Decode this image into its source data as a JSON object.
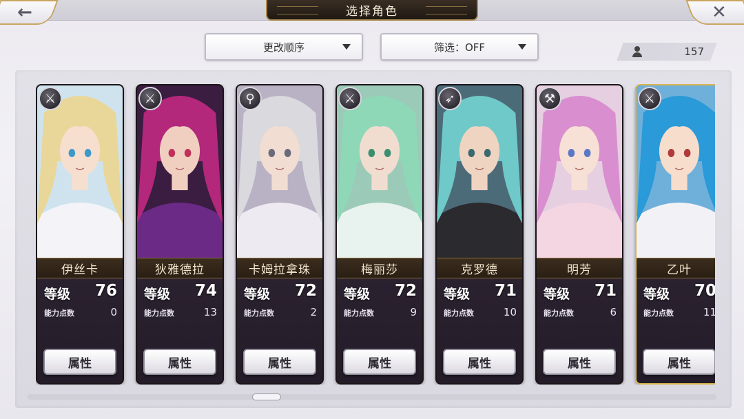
{
  "header": {
    "title": "选择角色",
    "back_icon": "←",
    "close_icon": "✕"
  },
  "toolbar": {
    "sort_label": "更改顺序",
    "filter_label": "筛选：OFF"
  },
  "roster": {
    "count": "157"
  },
  "labels": {
    "level": "等级",
    "ability_points": "能力点数",
    "attributes_button": "属性"
  },
  "characters": [
    {
      "name": "伊丝卡",
      "level": "76",
      "ability_points": "0",
      "weapon": "sword",
      "weapon_glyph": "⚔",
      "hair": "#e9d79a",
      "skin": "#f6dfcf",
      "outfit": "#f4f4f8",
      "bg": "#cfe3ef",
      "eye": "#3d9ac8"
    },
    {
      "name": "狄雅德拉",
      "level": "74",
      "ability_points": "13",
      "weapon": "sword",
      "weapon_glyph": "⚔",
      "hair": "#b3287a",
      "skin": "#f0cfc0",
      "outfit": "#6a2a86",
      "bg": "#3a1d40",
      "eye": "#c0305a"
    },
    {
      "name": "卡姆拉拿珠",
      "level": "72",
      "ability_points": "2",
      "weapon": "staff",
      "weapon_glyph": "⚲",
      "hair": "#d9d9de",
      "skin": "#f2ddd2",
      "outfit": "#eeeaf2",
      "bg": "#b9b2c4",
      "eye": "#6a6a7a"
    },
    {
      "name": "梅丽莎",
      "level": "72",
      "ability_points": "9",
      "weapon": "sword",
      "weapon_glyph": "⚔",
      "hair": "#8ed8b8",
      "skin": "#f1ddd0",
      "outfit": "#e8f2ee",
      "bg": "#9ccab8",
      "eye": "#3a8f70"
    },
    {
      "name": "克罗德",
      "level": "71",
      "ability_points": "10",
      "weapon": "bow",
      "weapon_glyph": "➶",
      "hair": "#6fc9c8",
      "skin": "#efd4c2",
      "outfit": "#2b2a2e",
      "bg": "#4c6b78",
      "eye": "#3a6a70"
    },
    {
      "name": "明芳",
      "level": "71",
      "ability_points": "6",
      "weapon": "hammer",
      "weapon_glyph": "⚒",
      "hair": "#d98fcf",
      "skin": "#f7e0d6",
      "outfit": "#f4d6e2",
      "bg": "#e6cfe0",
      "eye": "#5a78c8"
    },
    {
      "name": "乙叶",
      "level": "70",
      "ability_points": "11",
      "weapon": "sword",
      "weapon_glyph": "⚔",
      "hair": "#2a9ad8",
      "skin": "#f6ddcc",
      "outfit": "#f2f2f6",
      "bg": "#6fb0da",
      "eye": "#b03a3a"
    }
  ]
}
